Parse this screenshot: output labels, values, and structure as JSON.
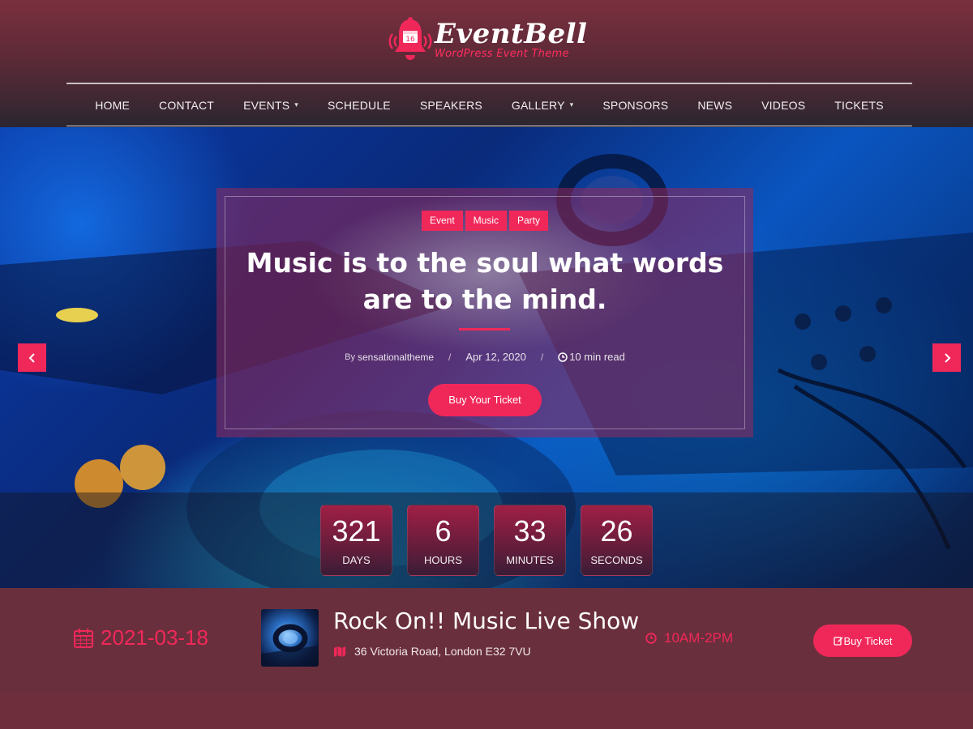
{
  "brand": {
    "name": "EventBell",
    "tagline": "WordPress Event Theme",
    "accent_color": "#f0285a"
  },
  "nav": {
    "items": [
      {
        "label": "HOME",
        "has_dropdown": false
      },
      {
        "label": "CONTACT",
        "has_dropdown": false
      },
      {
        "label": "EVENTS",
        "has_dropdown": true
      },
      {
        "label": "SCHEDULE",
        "has_dropdown": false
      },
      {
        "label": "SPEAKERS",
        "has_dropdown": false
      },
      {
        "label": "GALLERY",
        "has_dropdown": true
      },
      {
        "label": "SPONSORS",
        "has_dropdown": false
      },
      {
        "label": "NEWS",
        "has_dropdown": false
      },
      {
        "label": "VIDEOS",
        "has_dropdown": false
      },
      {
        "label": "TICKETS",
        "has_dropdown": false
      }
    ]
  },
  "hero": {
    "tags": [
      "Event",
      "Music",
      "Party"
    ],
    "title": "Music is to the soul what words are to the mind.",
    "by_label": "By",
    "author": "sensationaltheme",
    "separator": "/",
    "date": "Apr 12, 2020",
    "read_time": "10 min read",
    "button_label": "Buy Your Ticket",
    "prev_icon": "chevron-left-icon",
    "next_icon": "chevron-right-icon"
  },
  "countdown": [
    {
      "value": "321",
      "label": "DAYS"
    },
    {
      "value": "6",
      "label": "HOURS"
    },
    {
      "value": "33",
      "label": "MINUTES"
    },
    {
      "value": "26",
      "label": "SECONDS"
    }
  ],
  "event": {
    "date": "2021-03-18",
    "title": "Rock On!! Music Live Show",
    "location": "36 Victoria Road, London E32 7VU",
    "time": "10AM-2PM",
    "button_label": "Buy Ticket"
  }
}
